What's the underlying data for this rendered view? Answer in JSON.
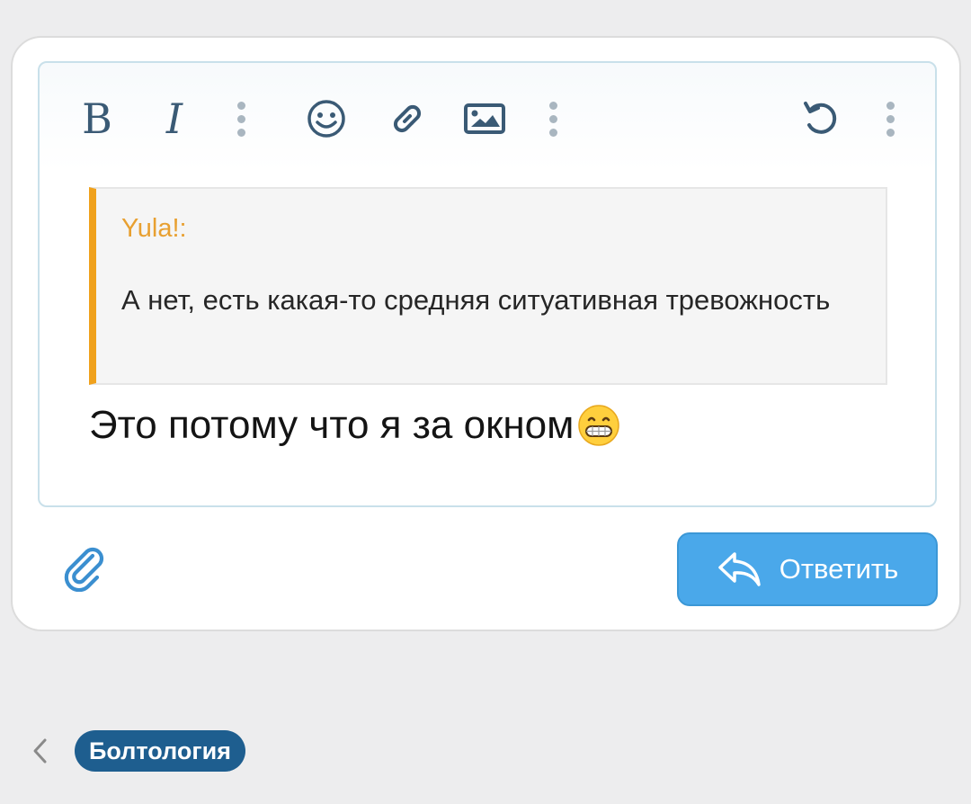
{
  "toolbar": {
    "bold_label": "B",
    "italic_label": "I",
    "icons": [
      "more-vertical-icon",
      "smiley-icon",
      "link-icon",
      "image-icon",
      "more-vertical-icon",
      "undo-icon",
      "more-vertical-icon"
    ]
  },
  "editor": {
    "quote": {
      "author": "Yula!:",
      "text": "А нет, есть какая-то средняя ситуативная тревожность"
    },
    "reply_text": "Это потому что я за окном",
    "emoji": "grinning-face-icon"
  },
  "actions": {
    "reply_label": "Ответить",
    "attach_icon": "paperclip-icon"
  },
  "breadcrumb": {
    "label": "Болтология"
  },
  "colors": {
    "accent": "#4aa8ea",
    "quote_bar": "#f0a11c",
    "quote_author": "#e8a031",
    "breadcrumb_bg": "#1e5e8f",
    "icon": "#3a5a75"
  }
}
